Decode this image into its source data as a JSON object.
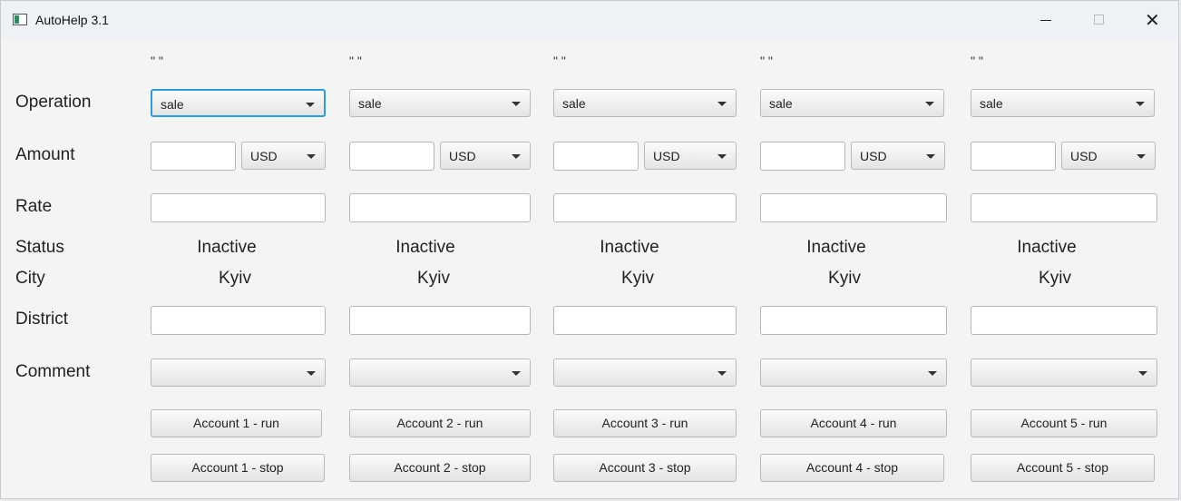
{
  "window": {
    "title": "AutoHelp 3.1"
  },
  "labels": {
    "operation": "Operation",
    "amount": "Amount",
    "rate": "Rate",
    "status": "Status",
    "city": "City",
    "district": "District",
    "comment": "Comment"
  },
  "accounts": [
    {
      "header": "\" \"",
      "operation": "sale",
      "amount": "",
      "currency": "USD",
      "rate": "",
      "status": "Inactive",
      "city": "Kyiv",
      "district": "",
      "comment": "",
      "run_label": "Account 1 - run",
      "stop_label": "Account 1 - stop"
    },
    {
      "header": "\" \"",
      "operation": "sale",
      "amount": "",
      "currency": "USD",
      "rate": "",
      "status": "Inactive",
      "city": "Kyiv",
      "district": "",
      "comment": "",
      "run_label": "Account 2 - run",
      "stop_label": "Account 2 - stop"
    },
    {
      "header": "\" \"",
      "operation": "sale",
      "amount": "",
      "currency": "USD",
      "rate": "",
      "status": "Inactive",
      "city": "Kyiv",
      "district": "",
      "comment": "",
      "run_label": "Account 3 - run",
      "stop_label": "Account 3 - stop"
    },
    {
      "header": "\" \"",
      "operation": "sale",
      "amount": "",
      "currency": "USD",
      "rate": "",
      "status": "Inactive",
      "city": "Kyiv",
      "district": "",
      "comment": "",
      "run_label": "Account 4 - run",
      "stop_label": "Account 4 - stop"
    },
    {
      "header": "\" \"",
      "operation": "sale",
      "amount": "",
      "currency": "USD",
      "rate": "",
      "status": "Inactive",
      "city": "Kyiv",
      "district": "",
      "comment": "",
      "run_label": "Account 5 - run",
      "stop_label": "Account 5 - stop"
    }
  ],
  "colors": {
    "focus_ring": "#2e9bdc",
    "window_bg": "#f4f4f4"
  }
}
